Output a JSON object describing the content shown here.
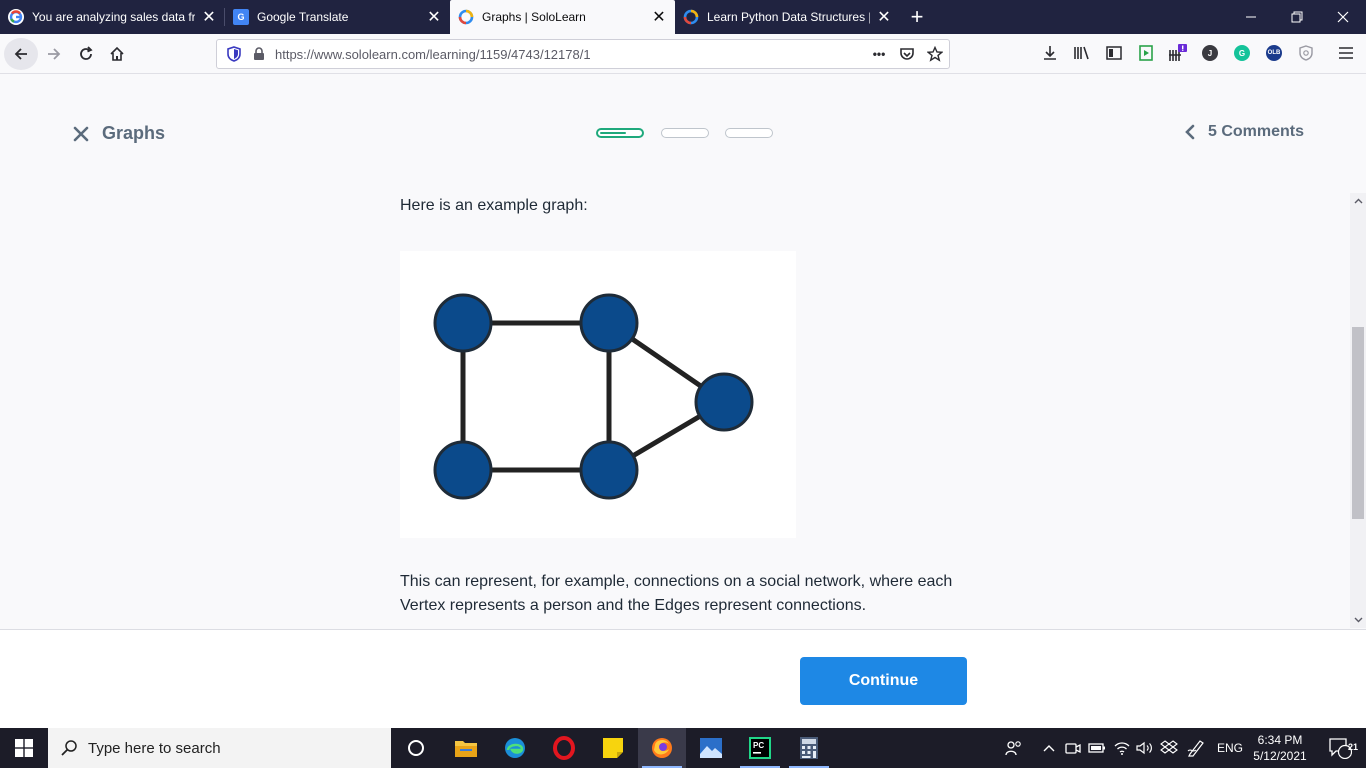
{
  "browser": {
    "tabs": [
      {
        "title": "You are analyzing sales data fro",
        "favicon": "google-icon",
        "active": false
      },
      {
        "title": "Google Translate",
        "favicon": "google-translate-icon",
        "active": false
      },
      {
        "title": "Graphs | SoloLearn",
        "favicon": "sololearn-icon",
        "active": true
      },
      {
        "title": "Learn Python Data Structures |",
        "favicon": "sololearn-icon",
        "active": false
      }
    ],
    "tab_close_glyph": "✕",
    "new_tab_glyph": "+",
    "url": "https://www.sololearn.com/learning/1159/4743/12178/1",
    "url_more_glyph": "•••",
    "window_controls": {
      "minimize": "—",
      "restore": "❐",
      "close": "✕"
    },
    "extension_badges": {
      "j": "J",
      "g": "G",
      "olb": "OLB"
    }
  },
  "lesson": {
    "title": "Graphs",
    "progress": [
      {
        "state": "current",
        "fill": 0.6
      },
      {
        "state": "pending",
        "fill": 0
      },
      {
        "state": "pending",
        "fill": 0
      }
    ],
    "comments_label": "5 Comments",
    "intro_text": "Here is an example graph:",
    "description": "This can represent, for example, connections on a social network, where each Vertex represents a person and the Edges represent connections.",
    "continue_label": "Continue"
  },
  "colors": {
    "tabbar_bg": "#202340",
    "vertex_fill": "#0b4a8b",
    "edge_color": "#222222",
    "progress_active": "#1fa97c",
    "continue_bg": "#1e88e5",
    "taskbar_bg": "#1c1c28"
  },
  "taskbar": {
    "search_placeholder": "Type here to search",
    "apps": [
      "cortana-icon",
      "file-explorer-icon",
      "edge-icon",
      "opera-icon",
      "sticky-notes-icon",
      "firefox-icon",
      "photos-icon",
      "pycharm-icon",
      "calculator-icon"
    ],
    "language": "ENG",
    "time": "6:34 PM",
    "date": "5/12/2021",
    "notification_count": "21"
  }
}
